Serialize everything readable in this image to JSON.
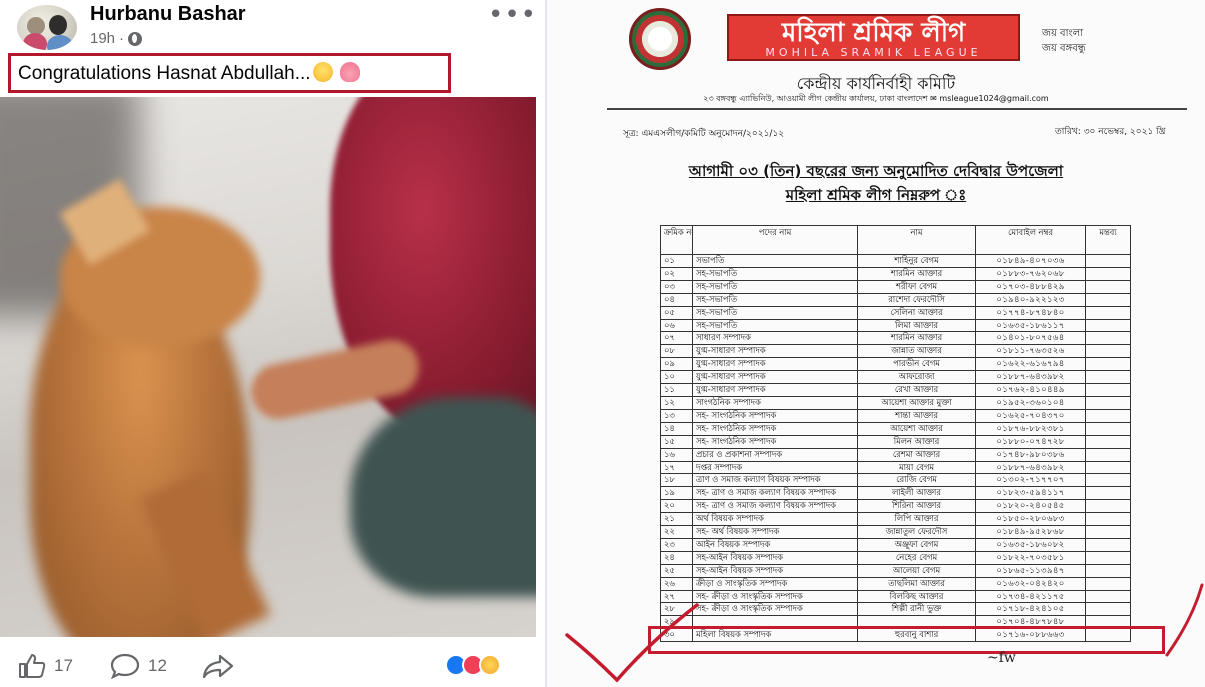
{
  "post": {
    "author": "Hurbanu Bashar",
    "time": "19h",
    "caption": "Congratulations Hasnat Abdullah...",
    "like_count": "17",
    "comment_count": "12",
    "more_icon": "more-options-icon",
    "audience_icon": "globe-icon",
    "volume_icon": "volume-icon"
  },
  "document": {
    "org_name_bn": "মহিলা শ্রমিক লীগ",
    "org_name_en": "MOHILA SRAMIK LEAGUE",
    "slogan_1": "জয় বাংলা",
    "slogan_2": "জয় বঙ্গবন্ধু",
    "committee": "কেন্দ্রীয় কার্যনির্বাহী কমিটি",
    "address": "২৩ বঙ্গবন্ধু এ্যাভিনিউ, আওয়ামী লীগ কেন্দ্রীয় কার্যালয়, ঢাকা বাংলাদেশ ✉ msleague1024@gmail.com",
    "ref": "সূত্র:       এমএসলীগ/কমিটি অনুমোদন/২০২১/১২",
    "date": "তারিখ: ৩০ নভেম্বর, ২০২১ খ্রি",
    "heading_1": "আগামী ০৩ (তিন) বছরের জন্য অনুমোদিত দেবিদ্বার উপজেলা",
    "heading_2": "মহিলা শ্রমিক লীগ নিম্নরুপ ঃ",
    "columns": [
      "ক্রমিক নং",
      "পদের নাম",
      "নাম",
      "মোবাইল নম্বর",
      "মন্তব্য"
    ],
    "rows": [
      [
        "০১",
        "সভাপতি",
        "শাহিনুর বেগম",
        "০১৮৪৯-৪০৭০৩৬"
      ],
      [
        "০২",
        "সহ-সভাপতি",
        "শারমিন আক্তার",
        "০১৮৮৩-৭৬২০৬৮"
      ],
      [
        "০৩",
        "সহ-সভাপতি",
        "শরীফা বেগম",
        "০১৭০৩-৪৮৮৪২৯"
      ],
      [
        "০৪",
        "সহ-সভাপতি",
        "রাশেদা ফেরদৌসি",
        "০১৯৪০-৯২২১২৩"
      ],
      [
        "০৫",
        "সহ-সভাপতি",
        "সেলিনা আক্তার",
        "০১৭৭৪-৮৭৪৮৪০"
      ],
      [
        "০৬",
        "সহ-সভাপতি",
        "লিমা আক্তার",
        "০১৬৩৫-১৮৬১১৭"
      ],
      [
        "০৭",
        "সাধারণ সম্পাদক",
        "শারমিন আক্তার",
        "০১৪০১-৮০৭৫৬৪"
      ],
      [
        "০৮",
        "যুগ্ম-সাধারণ সম্পাদক",
        "জান্নাত আক্তার",
        "০১৮১১-৭৬৩৫২৬"
      ],
      [
        "০৯",
        "যুগ্ম-সাধারণ সম্পাদক",
        "পারভীন বেগম",
        "০১৬২২-৬১৬৭৯৪"
      ],
      [
        "১০",
        "যুগ্ম-সাধারণ সম্পাদক",
        "আফরোজা",
        "০১৮৮৭-৬৪৩৯৮২"
      ],
      [
        "১১",
        "যুগ্ম-সাধারণ সম্পাদক",
        "রেখা আক্তার",
        "০১৭৬২-৪১০৪৪৯"
      ],
      [
        "১২",
        "সাংগঠনিক সম্পাদক",
        "আয়েশা আক্তার মুক্তা",
        "০১৯৫২-৩৬০১০৪"
      ],
      [
        "১৩",
        "সহ- সাংগঠনিক সম্পাদক",
        "শান্তা আক্তার",
        "০১৬২৫-৭০৪৩৭০"
      ],
      [
        "১৪",
        "সহ- সাংগঠনিক সম্পাদক",
        "আয়েশা আক্তার",
        "০১৮৭৬-৮৮২৩৮১"
      ],
      [
        "১৫",
        "সহ- সাংগঠনিক সম্পাদক",
        "মিলন আক্তার",
        "০১৮৮০-০৭৪৭২৮"
      ],
      [
        "১৬",
        "প্রচার ও প্রকাশনা সম্পাদক",
        "রেশমা আক্তার",
        "০১৭৪৮-৯৮০৩৮৬"
      ],
      [
        "১৭",
        "দপ্তর সম্পাদক",
        "মায়া বেগম",
        "০১৮৮৭-৬৪৩৯৮২"
      ],
      [
        "১৮",
        "ত্রাণ ও সমাজ কল্যাণ বিষয়ক সম্পাদক",
        "রোজি বেগম",
        "০১৩০২-৭১৭৭০৭"
      ],
      [
        "১৯",
        "সহ- ত্রাণ ও সমাজ কল্যাণ বিষয়ক সম্পাদক",
        "লাইলী আক্তার",
        "০১৮২৩-৫৯৪১১৭"
      ],
      [
        "২০",
        "সহ- ত্রাণ ও সমাজ কল্যাণ বিষয়ক সম্পাদক",
        "শিরিনা আক্তার",
        "০১৮২০-২৪০৫৪৫"
      ],
      [
        "২১",
        "অর্থ বিষয়ক সম্পাদক",
        "লিপি আক্তার",
        "০১৮৫০-২৮০৬৮৩"
      ],
      [
        "২২",
        "সহ- অর্থ বিষয়ক সম্পাদক",
        "জান্নাতুল ফেরদৌস",
        "০১৮৪৯-৯৫২৮৬৮"
      ],
      [
        "২৩",
        "আইন বিষয়ক সম্পাদক",
        "অঞ্জুফা বেগম",
        "০১৬৩৫-১৮৬০৮২"
      ],
      [
        "২৪",
        "সহ-আইন বিষয়ক সম্পাদক",
        "নেহের বেগম",
        "০১৮২২-৭০৩৫৮১"
      ],
      [
        "২৫",
        "সহ-আইন বিষয়ক সম্পাদক",
        "আলেয়া বেগম",
        "০১৮৬৫-১১৩৯৪৭"
      ],
      [
        "২৬",
        "ক্রীড়া ও সাংস্কৃতিক সম্পাদক",
        "তাছলিমা আক্তার",
        "০১৬৩২-০৪২৪২০"
      ],
      [
        "২৭",
        "সহ- ক্রীড়া ও সাংস্কৃতিক সম্পাদক",
        "বিলকিছ আক্তার",
        "০১৭৩৪-৪২১১৭৫"
      ],
      [
        "২৮",
        "সহ- ক্রীড়া ও সাংস্কৃতিক সম্পাদক",
        "শিল্পী রানী ভুক্ত",
        "০১৭১৮-৪২৪১০৫"
      ],
      [
        "২৯",
        "",
        "",
        "০১৭০৪-৪৮৭৮৪৮"
      ],
      [
        "৩০",
        "মহিলা বিষয়ক সম্পাদক",
        "হুরবানু বাশার",
        "০১৭১৬-০৮৮৬৬৩"
      ]
    ],
    "signature": "~fw"
  },
  "colors": {
    "highlight_red": "#c41c2e",
    "facebook_blue": "#1877f2",
    "banner_red": "#e23a35"
  }
}
